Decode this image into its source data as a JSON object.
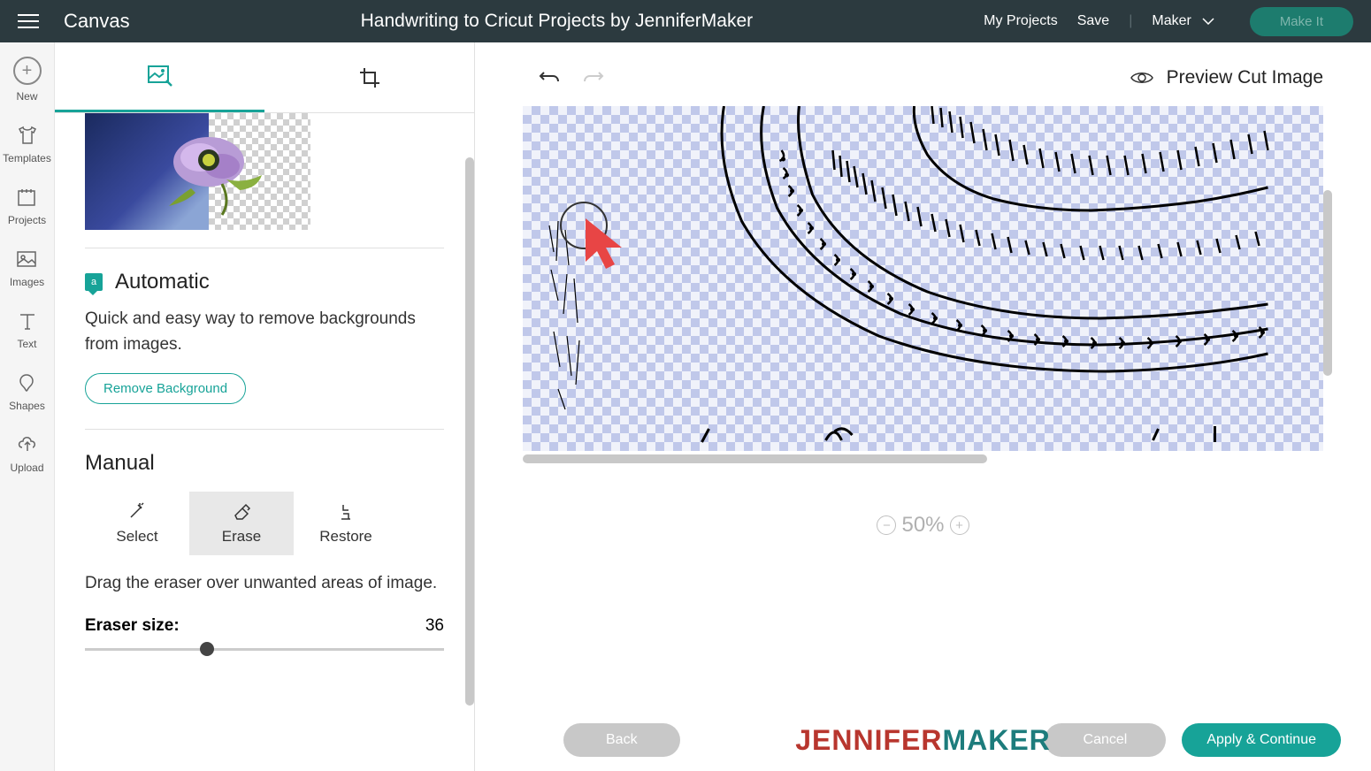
{
  "header": {
    "canvas_label": "Canvas",
    "project_title": "Handwriting to Cricut Projects by JenniferMaker",
    "my_projects": "My Projects",
    "save": "Save",
    "machine": "Maker",
    "make_it": "Make It"
  },
  "left_nav": {
    "new": "New",
    "templates": "Templates",
    "projects": "Projects",
    "images": "Images",
    "text": "Text",
    "shapes": "Shapes",
    "upload": "Upload"
  },
  "panel": {
    "automatic": {
      "title": "Automatic",
      "desc": "Quick and easy way to remove backgrounds from images.",
      "button": "Remove Background"
    },
    "manual": {
      "title": "Manual",
      "select": "Select",
      "erase": "Erase",
      "restore": "Restore",
      "desc": "Drag the eraser over unwanted areas of image.",
      "eraser_label": "Eraser size:",
      "eraser_value": "36"
    }
  },
  "canvas": {
    "preview_label": "Preview Cut Image",
    "zoom": "50%"
  },
  "footer": {
    "back": "Back",
    "cancel": "Cancel",
    "apply": "Apply & Continue",
    "watermark_1": "JENNIFER",
    "watermark_2": "MAKER"
  }
}
